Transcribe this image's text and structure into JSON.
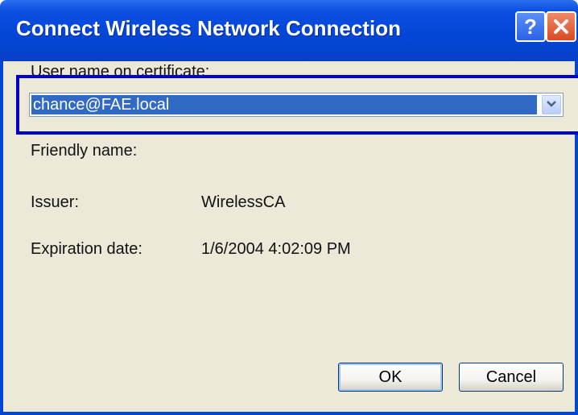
{
  "window": {
    "title": "Connect Wireless Network Connection",
    "title_buttons": [
      {
        "icon": "help-icon",
        "glyph": "?"
      },
      {
        "icon": "close-icon",
        "glyph": "✕"
      }
    ]
  },
  "form": {
    "user_label": "User name on certificate:",
    "user_value": "chance@FAE.local",
    "friendly_label": "Friendly name:",
    "issuer_label": "Issuer:",
    "issuer_value": "WirelessCA",
    "expiration_label": "Expiration date:",
    "expiration_value": "1/6/2004 4:02:09 PM"
  },
  "buttons": {
    "ok_label": "OK",
    "cancel_label": "Cancel"
  },
  "colors": {
    "title_bar": "#0346d6",
    "dialog_bg": "#ece9d8",
    "selection": "#316ac5",
    "highlight_box": "#0000cc",
    "close_button": "#d94a22"
  }
}
